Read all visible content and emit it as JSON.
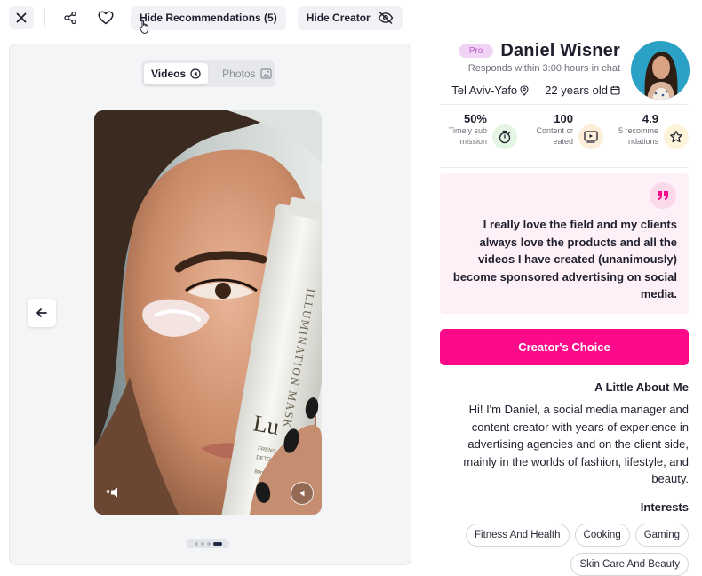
{
  "toolbar": {
    "close_icon": "close-icon",
    "share_icon": "share-icon",
    "heart_icon": "heart-icon",
    "hide_recommendations_label": "Hide Recommendations (5)",
    "hide_creator_label": "Hide Creator",
    "eye_off_icon": "eye-off-icon"
  },
  "media": {
    "tabs": [
      {
        "label": "Videos",
        "active": true,
        "icon": "video-play-icon"
      },
      {
        "label": "Photos",
        "active": false,
        "icon": "image-icon"
      }
    ],
    "video_text": {
      "brand_word": "Lu",
      "product_line": "ILLUMINATION MASK",
      "small_a": "FRENC",
      "small_b": "DETOX • HYD",
      "small_c": "80ml"
    },
    "pagination": {
      "count": 4,
      "active_index": 3
    }
  },
  "profile": {
    "badge": "Pro",
    "name": "Daniel Wisner",
    "responds": "Responds within 3:00 hours in chat",
    "location": "Tel Aviv-Yafo",
    "age": "22 years old",
    "stats": [
      {
        "value": "50%",
        "label": "Timely submission",
        "icon": "stopwatch-icon",
        "icon_bg": "#e3f5e3"
      },
      {
        "value": "100",
        "label": "Content created",
        "icon": "video-screen-icon",
        "icon_bg": "#fdeed9"
      },
      {
        "value": "4.9",
        "label": "5 recommendations",
        "icon": "star-icon",
        "icon_bg": "#fdf3d8"
      }
    ],
    "quote": "I really love the field and my clients always love the products and all the videos I have created (unanimously) become sponsored advertising on social media.",
    "choice_label": "Creator's Choice",
    "about_title": "A Little About Me",
    "about_text": "Hi! I'm Daniel, a social media manager and content creator with years of experience in advertising agencies and on the client side, mainly in the worlds of fashion, lifestyle, and beauty.",
    "interests_title": "Interests",
    "interests": [
      "Fitness And Health",
      "Cooking",
      "Gaming",
      "Skin Care And Beauty"
    ]
  },
  "colors": {
    "accent": "#fd0a8a",
    "quote_bg": "#fdf0f7",
    "pro_badge_bg": "#f1d4f5"
  }
}
